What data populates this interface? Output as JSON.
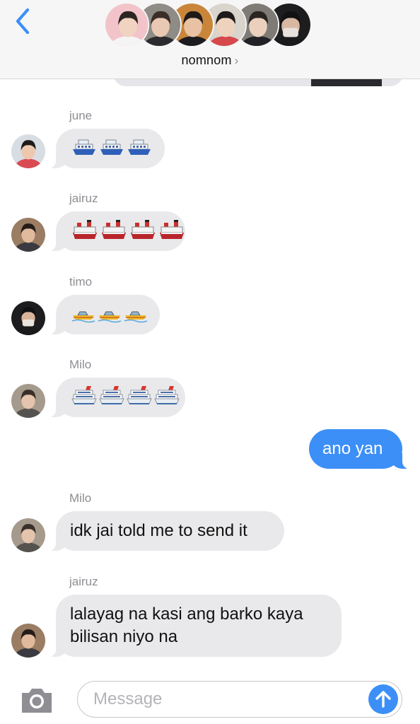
{
  "header": {
    "group_name": "nomnom",
    "chevron": "›",
    "back_icon": "chevron-left-icon",
    "member_avatars": [
      {
        "bg": "#f2c4c9",
        "skin": "#f1d3c1",
        "hair": "#2d2521",
        "shirt": "#f4f4f4"
      },
      {
        "bg": "#8f8b86",
        "skin": "#e9c9b3",
        "hair": "#3b2e28",
        "shirt": "#2c2c30"
      },
      {
        "bg": "#c9863a",
        "skin": "#e8c2a3",
        "hair": "#1f1a18",
        "shirt": "#1c1c20"
      },
      {
        "bg": "#d9d4cc",
        "skin": "#efd2bd",
        "hair": "#1d1a19",
        "shirt": "#d5484b"
      },
      {
        "bg": "#7e7b76",
        "skin": "#ead0bd",
        "hair": "#2a2422",
        "shirt": "#222226"
      },
      {
        "bg": "#1d1d20",
        "skin": "#d9b8a2",
        "hair": "#121212",
        "shirt": "#1a1a1c",
        "mask": "#e7e2dc"
      }
    ]
  },
  "messages": [
    {
      "sender": "june",
      "type": "emoji",
      "emoji": "passenger-ferry",
      "count": 3,
      "avatar": {
        "bg": "#d8dde3",
        "skin": "#edc8ae",
        "hair": "#1e1b1b",
        "shirt": "#d94a52"
      }
    },
    {
      "sender": "jairuz",
      "type": "emoji",
      "emoji": "ocean-liner",
      "count": 4,
      "avatar": {
        "bg": "#9a7d62",
        "skin": "#e1b99c",
        "hair": "#241c18",
        "shirt": "#3a3a40"
      }
    },
    {
      "sender": "timo",
      "type": "emoji",
      "emoji": "speedboat",
      "count": 3,
      "avatar": {
        "bg": "#1d1d20",
        "skin": "#d8b29b",
        "hair": "#111",
        "shirt": "#1a1a1c",
        "mask": "#e9e4de"
      }
    },
    {
      "sender": "Milo",
      "type": "emoji",
      "emoji": "cruise-ship",
      "count": 4,
      "avatar": {
        "bg": "#a59a8c",
        "skin": "#e4c4ad",
        "hair": "#3a3029",
        "shirt": "#55534f"
      }
    },
    {
      "sender": "me",
      "type": "text",
      "text": "ano yan"
    },
    {
      "sender": "Milo",
      "type": "text",
      "text": "idk jai told me to send it",
      "avatar": {
        "bg": "#a59a8c",
        "skin": "#e4c4ad",
        "hair": "#3a3029",
        "shirt": "#55534f"
      }
    },
    {
      "sender": "jairuz",
      "type": "text",
      "text": "lalayag na kasi ang barko kaya\nbilisan niyo na",
      "avatar": {
        "bg": "#9a7d62",
        "skin": "#e1b99c",
        "hair": "#241c18",
        "shirt": "#3a3a40"
      }
    }
  ],
  "input": {
    "placeholder": "Message",
    "camera_icon": "camera-icon",
    "send_icon": "arrow-up-icon"
  },
  "colors": {
    "accent": "#3c8ff7",
    "incoming_bubble": "#e9e9eb",
    "sender_label": "#8e8e93"
  }
}
